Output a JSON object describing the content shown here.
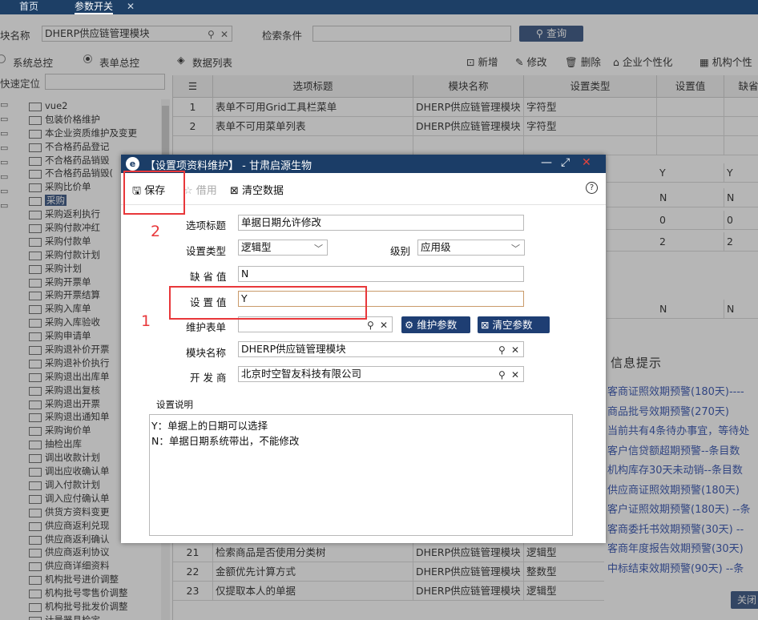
{
  "tabs": [
    {
      "label": "首页"
    },
    {
      "label": "参数开关"
    }
  ],
  "tab_close": "✕",
  "filter": {
    "module_label": "块名称",
    "module_value": "DHERP供应链管理模块",
    "search_label": "检索条件",
    "search_value": "",
    "query_button": "查询"
  },
  "view_options": [
    "系统总控",
    "表单总控",
    "数据列表"
  ],
  "toolbar": [
    "新增",
    "修改",
    "删除",
    "企业个性化",
    "机构个性"
  ],
  "sidebar": {
    "quick_label": "快速定位",
    "items": [
      "vue2",
      "包装价格维护",
      "本企业资质维护及变更",
      "不合格药品登记",
      "不合格药品销毁",
      "不合格药品销毁(",
      "采购比价单",
      "采购",
      "采购返利执行",
      "采购付款冲红",
      "采购付款单",
      "采购付款计划",
      "采购计划",
      "采购开票单",
      "采购开票结算",
      "采购入库单",
      "采购入库验收",
      "采购申请单",
      "采购退补价开票",
      "采购退补价执行",
      "采购退出出库单",
      "采购退出复核",
      "采购退出开票",
      "采购退出通知单",
      "采购询价单",
      "抽检出库",
      "调出收款计划",
      "调出应收确认单",
      "调入付款计划",
      "调入应付确认单",
      "供货方资料变更",
      "供应商返利兑现",
      "供应商返利确认",
      "供应商返利协议",
      "供应商详细资料",
      "机构批号进价调整",
      "机构批号零售价调整",
      "机构批号批发价调整",
      "计量器具检定"
    ]
  },
  "grid": {
    "headers": [
      "选项标题",
      "模块名称",
      "设置类型",
      "设置值",
      "缺省"
    ],
    "rows_top": [
      {
        "no": "1",
        "title": "表单不可用Grid工具栏菜单",
        "module": "DHERP供应链管理模块",
        "type": "字符型",
        "value": "",
        "default": ""
      },
      {
        "no": "2",
        "title": "表单不可用菜单列表",
        "module": "DHERP供应链管理模块",
        "type": "字符型",
        "value": "",
        "default": ""
      }
    ],
    "right_values": [
      {
        "value": "Y",
        "default": "Y"
      },
      {
        "value": "N",
        "default": "N"
      },
      {
        "value": "0",
        "default": "0"
      },
      {
        "value": "2",
        "default": "2"
      },
      {
        "value": "N",
        "default": "N"
      }
    ],
    "rows_bottom": [
      {
        "no": "21",
        "title": "检索商品是否使用分类树",
        "module": "DHERP供应链管理模块",
        "type": "逻辑型"
      },
      {
        "no": "22",
        "title": "金额优先计算方式",
        "module": "DHERP供应链管理模块",
        "type": "整数型"
      },
      {
        "no": "23",
        "title": "仅提取本人的单据",
        "module": "DHERP供应链管理模块",
        "type": "逻辑型"
      }
    ]
  },
  "messages": {
    "title": "信息提示",
    "items": [
      "客商证照效期预警(180天)----",
      "商品批号效期预警(270天)",
      "当前共有4条待办事宜，等待处",
      "客户信贷额超期预警--条目数",
      "机构库存30天未动销--条目数",
      "供应商证照效期预警(180天)",
      "客户证照效期预警(180天) --条",
      "客商委托书效期预警(30天) --",
      "客商年度报告效期预警(30天)",
      "中标结束效期预警(90天) --条"
    ],
    "close_label": "关闭"
  },
  "dialog": {
    "title": "【设置项资料维护】 - 甘肃启源生物",
    "save_label": "保存",
    "borrow_label": "借用",
    "clear_label": "清空数据",
    "fields": {
      "title_label": "选项标题",
      "title_value": "单据日期允许修改",
      "type_label": "设置类型",
      "type_value": "逻辑型",
      "level_label": "级别",
      "level_value": "应用级",
      "default_label": "缺 省 值",
      "default_value": "N",
      "setting_label": "设 置 值",
      "setting_value": "Y",
      "form_label": "维护表单",
      "form_value": "",
      "maintain_param": "维护参数",
      "clear_param": "清空参数",
      "module_label": "模块名称",
      "module_value": "DHERP供应链管理模块",
      "developer_label": "开 发 商",
      "developer_value": "北京时空智友科技有限公司"
    },
    "desc_label": "设置说明",
    "desc_lines": [
      "Y：单据上的日期可以选择",
      "N：单据日期系统带出，不能修改"
    ]
  },
  "annotations": [
    "1",
    "2"
  ],
  "colors": {
    "accent": "#1e3e73",
    "title_bar": "#1b3d67",
    "annotation": "#e8373a"
  }
}
